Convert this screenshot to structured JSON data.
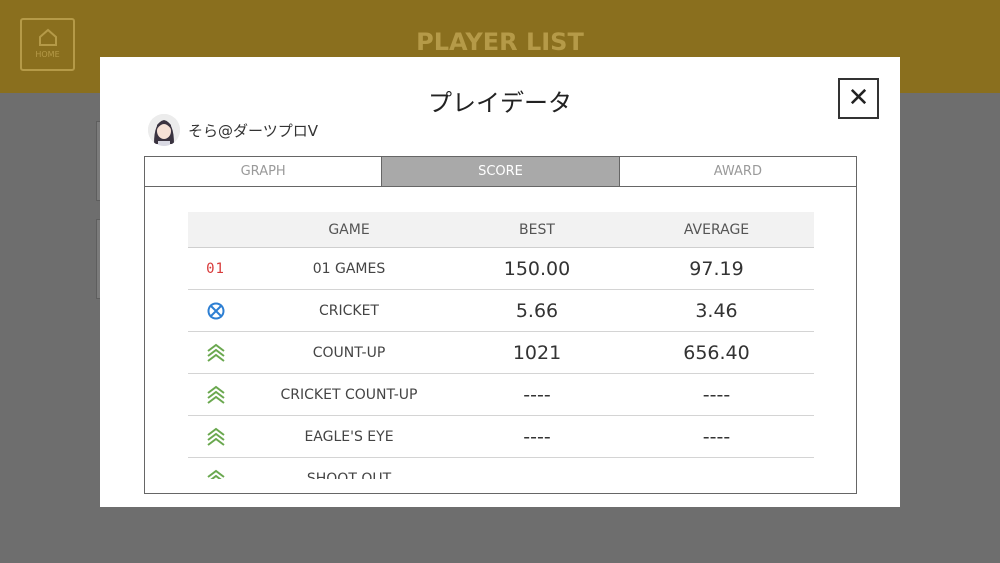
{
  "background": {
    "home_label": "HOME",
    "title": "PLAYER LIST"
  },
  "modal": {
    "title": "プレイデータ",
    "close_label": "✕",
    "player_name": "そら@ダーツプロV",
    "tabs": [
      {
        "label": "GRAPH",
        "active": false
      },
      {
        "label": "SCORE",
        "active": true
      },
      {
        "label": "AWARD",
        "active": false
      }
    ],
    "table": {
      "headers": {
        "game": "GAME",
        "best": "BEST",
        "average": "AVERAGE"
      },
      "rows": [
        {
          "icon": "01-games-icon",
          "game": "01 GAMES",
          "best": "150.00",
          "average": "97.19"
        },
        {
          "icon": "cricket-icon",
          "game": "CRICKET",
          "best": "5.66",
          "average": "3.46"
        },
        {
          "icon": "practice-chevrons-icon",
          "game": "COUNT-UP",
          "best": "1021",
          "average": "656.40"
        },
        {
          "icon": "practice-chevrons-icon",
          "game": "CRICKET COUNT-UP",
          "best": "----",
          "average": "----"
        },
        {
          "icon": "practice-chevrons-icon",
          "game": "EAGLE'S EYE",
          "best": "----",
          "average": "----"
        },
        {
          "icon": "practice-chevrons-icon",
          "game": "SHOOT OUT",
          "best": "----",
          "average": "----"
        }
      ]
    }
  },
  "colors": {
    "header_accent": "#e0b33a",
    "icon_01": "#d83a3a",
    "icon_cricket": "#2d7fd3",
    "icon_practice": "#6aa84f"
  }
}
